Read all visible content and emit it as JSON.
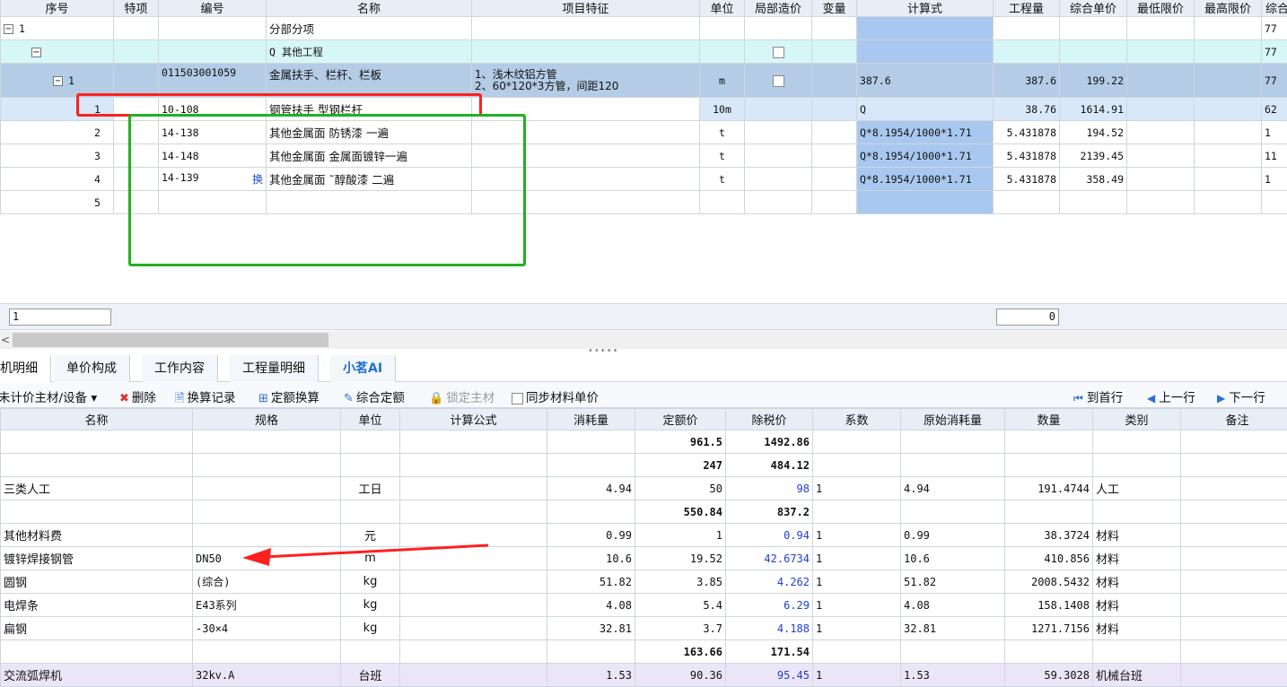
{
  "top_table": {
    "columns": [
      "序号",
      "特项",
      "编号",
      "名称",
      "项目特征",
      "单位",
      "局部造价",
      "变量",
      "计算式",
      "工程量",
      "综合单价",
      "最低限价",
      "最高限价",
      "综合"
    ],
    "rows": [
      {
        "seq": "1",
        "code": "",
        "name": "分部分项",
        "feature": "",
        "unit": "",
        "calc": "",
        "qty": "",
        "price": "",
        "total": "77"
      },
      {
        "seq": "",
        "code": "",
        "name": "Q 其他工程",
        "feature": "",
        "unit": "",
        "calc": "",
        "qty": "",
        "price": "",
        "total": "77"
      },
      {
        "seq": "1",
        "code": "011503001059",
        "name": "金属扶手、栏杆、栏板",
        "feature1": "1、浅木纹铝方管",
        "feature2": "2、60*120*3方管，间距120",
        "unit": "m",
        "calc": "387.6",
        "qty": "387.6",
        "price": "199.22",
        "total": "77"
      },
      {
        "seq": "1",
        "code": "10-108",
        "name": "钢管扶手 型钢栏杆",
        "unit": "10m",
        "calc": "Q",
        "qty": "38.76",
        "price": "1614.91",
        "total": "62"
      },
      {
        "seq": "2",
        "code": "14-138",
        "name": "其他金属面 防锈漆 一遍",
        "unit": "t",
        "calc": "Q*8.1954/1000*1.71",
        "qty": "5.431878",
        "price": "194.52",
        "total": "1"
      },
      {
        "seq": "3",
        "code": "14-148",
        "name": "其他金属面 金属面镀锌一遍",
        "unit": "t",
        "calc": "Q*8.1954/1000*1.71",
        "qty": "5.431878",
        "price": "2139.45",
        "total": "11"
      },
      {
        "seq": "4",
        "code": "14-139",
        "huan": "换",
        "name": "其他金属面 ˜醇酸漆 二遍",
        "unit": "t",
        "calc": "Q*8.1954/1000*1.71",
        "qty": "5.431878",
        "price": "358.49",
        "total": "1"
      },
      {
        "seq": "5"
      }
    ],
    "footer_left_input": "1",
    "footer_right_input": "0"
  },
  "tabs": [
    {
      "label": "机明细"
    },
    {
      "label": "单价构成"
    },
    {
      "label": "工作内容"
    },
    {
      "label": "工程量明细"
    },
    {
      "label": "小茗AI"
    }
  ],
  "toolbar": {
    "unpriced": "未计价主材/设备 ▾",
    "delete": "删除",
    "change_record": "换算记录",
    "quota_convert": "定额换算",
    "comprehensive_quota": "综合定额",
    "lock_material": "锁定主材",
    "sync_price": "同步材料单价",
    "first_row": "到首行",
    "prev_row": "上一行",
    "next_row": "下一行"
  },
  "bottom_table": {
    "columns": [
      "名称",
      "规格",
      "单位",
      "计算公式",
      "消耗量",
      "定额价",
      "除税价",
      "系数",
      "原始消耗量",
      "数量",
      "类别",
      "备注"
    ],
    "rows": [
      {
        "name": "",
        "spec": "",
        "unit": "",
        "consume": "",
        "quota": "961.5",
        "tax": "1492.86",
        "coef": "",
        "orig": "",
        "qty": "",
        "cat": "",
        "bold": true
      },
      {
        "name": "",
        "spec": "",
        "unit": "",
        "consume": "",
        "quota": "247",
        "tax": "484.12",
        "coef": "",
        "orig": "",
        "qty": "",
        "cat": "",
        "bold": true
      },
      {
        "name": "三类人工",
        "spec": "",
        "unit": "工日",
        "consume": "4.94",
        "quota": "50",
        "tax": "98",
        "coef": "1",
        "orig": "4.94",
        "qty": "191.4744",
        "cat": "人工"
      },
      {
        "name": "",
        "spec": "",
        "unit": "",
        "consume": "",
        "quota": "550.84",
        "tax": "837.2",
        "coef": "",
        "orig": "",
        "qty": "",
        "cat": "",
        "bold": true
      },
      {
        "name": "其他材料费",
        "spec": "",
        "unit": "元",
        "consume": "0.99",
        "quota": "1",
        "tax": "0.94",
        "coef": "1",
        "orig": "0.99",
        "qty": "38.3724",
        "cat": "材料"
      },
      {
        "name": "镀锌焊接钢管",
        "spec": "DN50",
        "unit": "m",
        "consume": "10.6",
        "quota": "19.52",
        "tax": "42.6734",
        "coef": "1",
        "orig": "10.6",
        "qty": "410.856",
        "cat": "材料"
      },
      {
        "name": "圆钢",
        "spec": "(综合)",
        "unit": "kg",
        "consume": "51.82",
        "quota": "3.85",
        "tax": "4.262",
        "coef": "1",
        "orig": "51.82",
        "qty": "2008.5432",
        "cat": "材料"
      },
      {
        "name": "电焊条",
        "spec": "E43系列",
        "unit": "kg",
        "consume": "4.08",
        "quota": "5.4",
        "tax": "6.29",
        "coef": "1",
        "orig": "4.08",
        "qty": "158.1408",
        "cat": "材料"
      },
      {
        "name": "扁钢",
        "spec": "-30×4",
        "unit": "kg",
        "consume": "32.81",
        "quota": "3.7",
        "tax": "4.188",
        "coef": "1",
        "orig": "32.81",
        "qty": "1271.7156",
        "cat": "材料"
      },
      {
        "name": "",
        "spec": "",
        "unit": "",
        "consume": "",
        "quota": "163.66",
        "tax": "171.54",
        "coef": "",
        "orig": "",
        "qty": "",
        "cat": "",
        "bold": true
      },
      {
        "name": "交流弧焊机",
        "spec": "32kv.A",
        "unit": "台班",
        "consume": "1.53",
        "quota": "90.36",
        "tax": "95.45",
        "coef": "1",
        "orig": "1.53",
        "qty": "59.3028",
        "cat": "机械台班",
        "mech": true
      }
    ]
  },
  "colors": {
    "red_annotation": "#ff2020",
    "green_annotation": "#22b022",
    "arrow": "#ff2020",
    "calc_column": "#a9c8ef",
    "selected_row": "#b4cce6"
  }
}
